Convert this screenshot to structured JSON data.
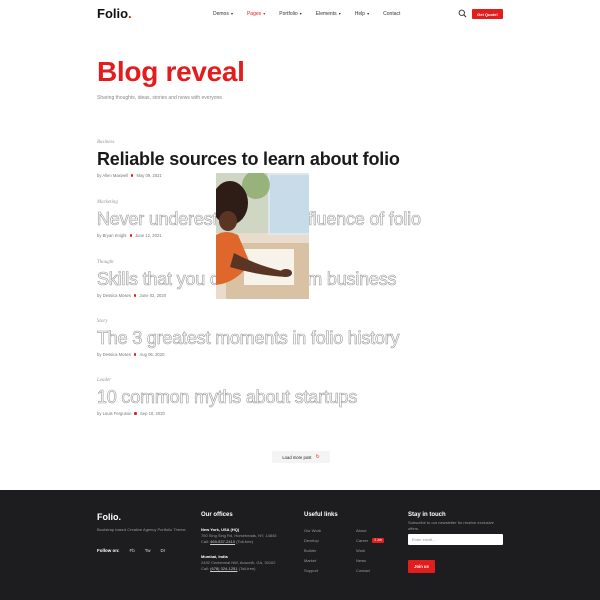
{
  "header": {
    "logo_text": "Folio",
    "logo_dot": ".",
    "nav": [
      {
        "label": "Demos",
        "active": false
      },
      {
        "label": "Pages",
        "active": true
      },
      {
        "label": "Portfolio",
        "active": false
      },
      {
        "label": "Elements",
        "active": false
      },
      {
        "label": "Help",
        "active": false
      },
      {
        "label": "Contact",
        "active": false
      }
    ],
    "quote_button": "Get Quote!"
  },
  "hero": {
    "title": "Blog reveal",
    "subtitle": "Sharing thoughts, ideas, stories and news with everyone."
  },
  "posts": [
    {
      "category": "Business",
      "title": "Reliable sources to learn about folio",
      "author": "by Allen Maxwell",
      "date": "May 09, 2021"
    },
    {
      "category": "Marketing",
      "title": "Never underestimate the influence of folio",
      "author": "by Bryan Knight",
      "date": "June 12, 2021"
    },
    {
      "category": "Thought",
      "title": "Skills that you can learn from business",
      "author": "by Dessica Moses",
      "date": "June 02, 2020"
    },
    {
      "category": "Story",
      "title": "The 3 greatest moments in folio history",
      "author": "by Dessica Moses",
      "date": "Aug 06, 2020"
    },
    {
      "category": "Leader",
      "title": "10 common myths about startups",
      "author": "by Louis Ferguson",
      "date": "Sep 10, 2020"
    }
  ],
  "load_more": "Load more post",
  "footer": {
    "logo": "Folio.",
    "description": "Bootstrap based Creative Agency Portfolio Theme.",
    "follow_label": "Follow on:",
    "socials": [
      "Fb",
      "Tw",
      "Dr"
    ],
    "offices_title": "Our offices",
    "office1_name": "New York, USA (HQ)",
    "office1_address": "750 Sing Sing Rd, Horseheads, NY, 14845",
    "office1_call_label": "Call:",
    "office1_phone": "469-537-2410",
    "office1_hours": "(Toll-free)",
    "office2_name": "Mumbai, India",
    "office2_address": "2492 Centennial NW, Acworth, GA, 30102",
    "office2_call_label": "Call:",
    "office2_phone": "(678) 324-1251",
    "office2_hours": "(Toll-free)",
    "links_title": "Useful links",
    "links_col1": [
      "Our Work",
      "Develop",
      "Builder",
      "Market",
      "Support"
    ],
    "links_col2": [
      "About",
      "Career",
      "Work",
      "News",
      "Contact"
    ],
    "career_badge": "2 Job",
    "newsletter_title": "Stay in touch",
    "newsletter_text": "Subscribe to our newsletter for receive exclusive offers.",
    "email_placeholder": "Enter email...",
    "join_button": "Join us"
  },
  "colors": {
    "accent": "#e31d1d",
    "footer_bg": "#1d1d1f"
  },
  "icons": {
    "search": "search-icon",
    "refresh": "refresh-icon"
  }
}
